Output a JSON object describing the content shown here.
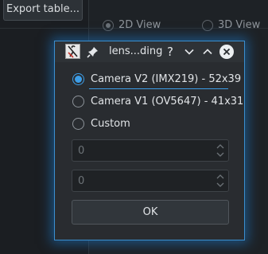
{
  "background": {
    "export_button_label": "Export table...",
    "view_options": [
      {
        "label": "2D View",
        "selected": true
      },
      {
        "label": "3D View",
        "selected": false
      }
    ]
  },
  "dialog": {
    "title": "lens...ding",
    "title_buttons": {
      "help": "?",
      "minimize": "chevron-down-icon",
      "maximize": "chevron-up-icon",
      "close": "close-icon"
    },
    "options": [
      {
        "label": "Camera V2 (IMX219) - 52x39",
        "selected": true
      },
      {
        "label": "Camera V1 (OV5647) - 41x31",
        "selected": false
      },
      {
        "label": "Custom",
        "selected": false
      }
    ],
    "width_value": "0",
    "height_value": "0",
    "ok_label": "OK"
  },
  "colors": {
    "accent": "#3d9ee8",
    "dialog_bg": "#292c30",
    "window_bg": "#1e2226"
  }
}
